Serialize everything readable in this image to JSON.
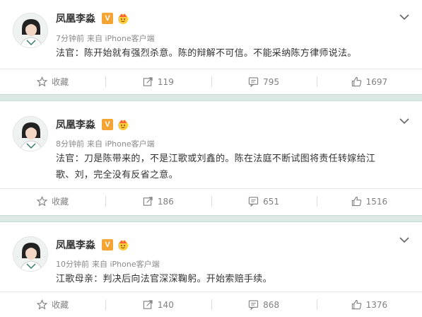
{
  "posts": [
    {
      "author": "凤凰李淼",
      "verified_badge": "V",
      "time": "7分钟前",
      "source": "来自 iPhone客户端",
      "text": "法官：陈开始就有强烈杀意。陈的辩解不可信。不能采纳陈方律师说法。",
      "actions": {
        "fav": "收藏",
        "repost": "119",
        "comment": "795",
        "like": "1697"
      }
    },
    {
      "author": "凤凰李淼",
      "verified_badge": "V",
      "time": "8分钟前",
      "source": "来自 iPhone客户端",
      "text_line1": "法官：刀是陈带来的，不是江歌或刘鑫的。陈在法庭不断试图将责任转嫁给江",
      "text_line2": "歌、刘，完全没有反省之意。",
      "actions": {
        "fav": "收藏",
        "repost": "186",
        "comment": "651",
        "like": "1516"
      }
    },
    {
      "author": "凤凰李淼",
      "verified_badge": "V",
      "time": "10分钟前",
      "source": "来自 iPhone客户端",
      "text": "江歌母亲：判决后向法官深深鞠躬。开始索赔手续。",
      "actions": {
        "fav": "收藏",
        "repost": "140",
        "comment": "868",
        "like": "1376"
      }
    }
  ],
  "colors": {
    "badge": "#f3a433",
    "separator": "#dce8e4",
    "muted": "#808080"
  }
}
